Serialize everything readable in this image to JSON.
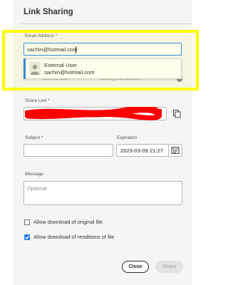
{
  "dialog": {
    "title": "Link Sharing"
  },
  "email": {
    "label": "Email Address *",
    "value": "sachin@hotmail.com",
    "suggestion": {
      "name": "External User",
      "email": "sachin@hotmail.com"
    },
    "obscured_left": "External Use",
    "obscured_right": "sachin@hotmail.com"
  },
  "share_link": {
    "label": "Share Link *"
  },
  "subject": {
    "label": "Subject *",
    "value": ""
  },
  "expiration": {
    "label": "Expiration",
    "value": "2023-03-09 21:27"
  },
  "message": {
    "label": "Message",
    "placeholder": "Optional"
  },
  "options": [
    {
      "label": "Allow download of original file",
      "checked": false
    },
    {
      "label": "Allow download of renditions of file",
      "checked": true
    }
  ],
  "actions": {
    "close": "Close",
    "share": "Share"
  },
  "colors": {
    "highlight": "#ffff00",
    "accent": "#2680eb",
    "redaction": "#ff0000"
  },
  "icons": {
    "copy": "copy-icon",
    "calendar": "calendar-icon",
    "avatar": "user-avatar-icon",
    "check": "checkmark-icon"
  }
}
